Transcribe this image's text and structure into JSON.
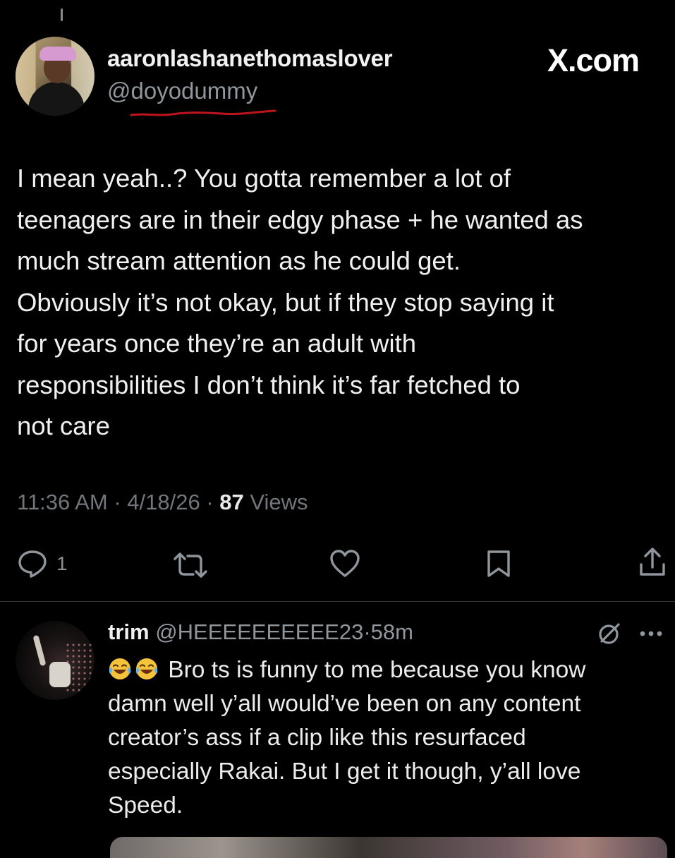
{
  "tweet": {
    "display_name": "aaronlashanethomaslover",
    "handle": "@doyodummy",
    "brand": "X.com",
    "text_lines": [
      "I mean yeah..? You gotta remember a lot of",
      "teenagers are in their edgy phase + he wanted as",
      "much stream attention as he could get.",
      "Obviously it’s not okay, but if they stop saying it",
      "for years once they’re an adult with",
      "responsibilities I don’t think it’s far fetched to",
      "not care"
    ],
    "time": "11:36 AM",
    "date": "4/18/26",
    "views_count": "87",
    "views_label": "Views",
    "separator": "·",
    "reply_count": "1",
    "icons": [
      "reply-icon",
      "retweet-icon",
      "like-icon",
      "bookmark-icon",
      "share-icon"
    ]
  },
  "reply": {
    "display_name": "trim",
    "handle": "@HEEEEEEEEEE23",
    "separator": "·",
    "time_ago": "58m",
    "text_line1_suffix": " Bro ts is funny to me because you know",
    "text_lines": [
      "damn well y’all would’ve been on any content",
      "creator’s ass if a clip like this resurfaced",
      "especially Rakai. But I get it though, y’all love",
      "Speed."
    ],
    "icons": [
      "grok-icon",
      "more-icon"
    ]
  },
  "colors": {
    "background": "#000000",
    "text": "#e7e9ea",
    "muted": "#71767b",
    "underline": "#c0141c"
  }
}
